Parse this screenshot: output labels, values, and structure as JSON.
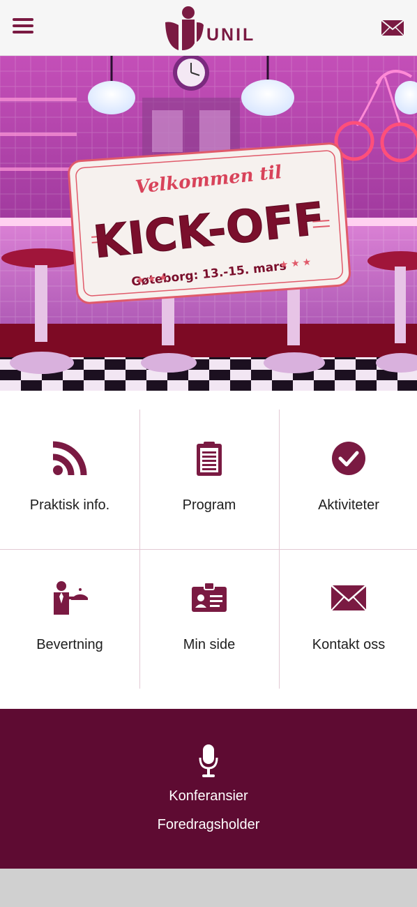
{
  "header": {
    "logo_text": "UNIL",
    "menu_icon": "hamburger-menu-icon",
    "mail_icon": "envelope-icon",
    "brand_color": "#7a1a42"
  },
  "hero": {
    "greeting": "Velkommen til",
    "title": "KICK-OFF",
    "subtitle": "Gøteborg: 13.-15. mars"
  },
  "tiles": [
    {
      "label": "Praktisk info.",
      "icon": "rss-feed-icon"
    },
    {
      "label": "Program",
      "icon": "clipboard-icon"
    },
    {
      "label": "Aktiviteter",
      "icon": "check-circle-icon"
    },
    {
      "label": "Bevertning",
      "icon": "waiter-serving-icon"
    },
    {
      "label": "Min side",
      "icon": "id-card-icon"
    },
    {
      "label": "Kontakt oss",
      "icon": "envelope-icon"
    }
  ],
  "speakers": {
    "icon": "microphone-icon",
    "primary": "Konferansier",
    "secondary": "Foredragsholder",
    "background": "#5e0b32"
  }
}
